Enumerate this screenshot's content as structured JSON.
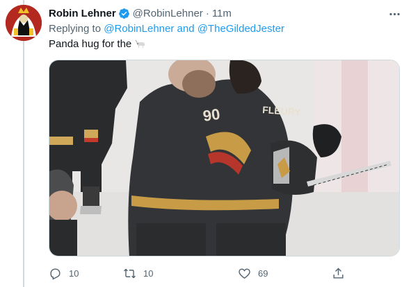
{
  "tweet": {
    "display_name": "Robin Lehner",
    "handle": "@RobinLehner",
    "separator": "·",
    "time": "11m",
    "replying_prefix": "Replying to",
    "replying_mentions": "@RobinLehner and @TheGildedJester",
    "text": "Panda hug for the",
    "emoji": "goat-emoji",
    "media": {
      "alt": "Two Vegas Golden Knights players hugging on the ice",
      "jersey_name": "FLEURY",
      "jersey_number": "90"
    },
    "actions": {
      "reply_count": "10",
      "retweet_count": "10",
      "like_count": "69",
      "reply_icon": "reply-icon",
      "retweet_icon": "retweet-icon",
      "like_icon": "heart-icon",
      "share_icon": "share-icon"
    }
  },
  "colors": {
    "brand_blue": "#1d9bf0",
    "secondary_text": "#536471",
    "primary_text": "#0f1419"
  }
}
